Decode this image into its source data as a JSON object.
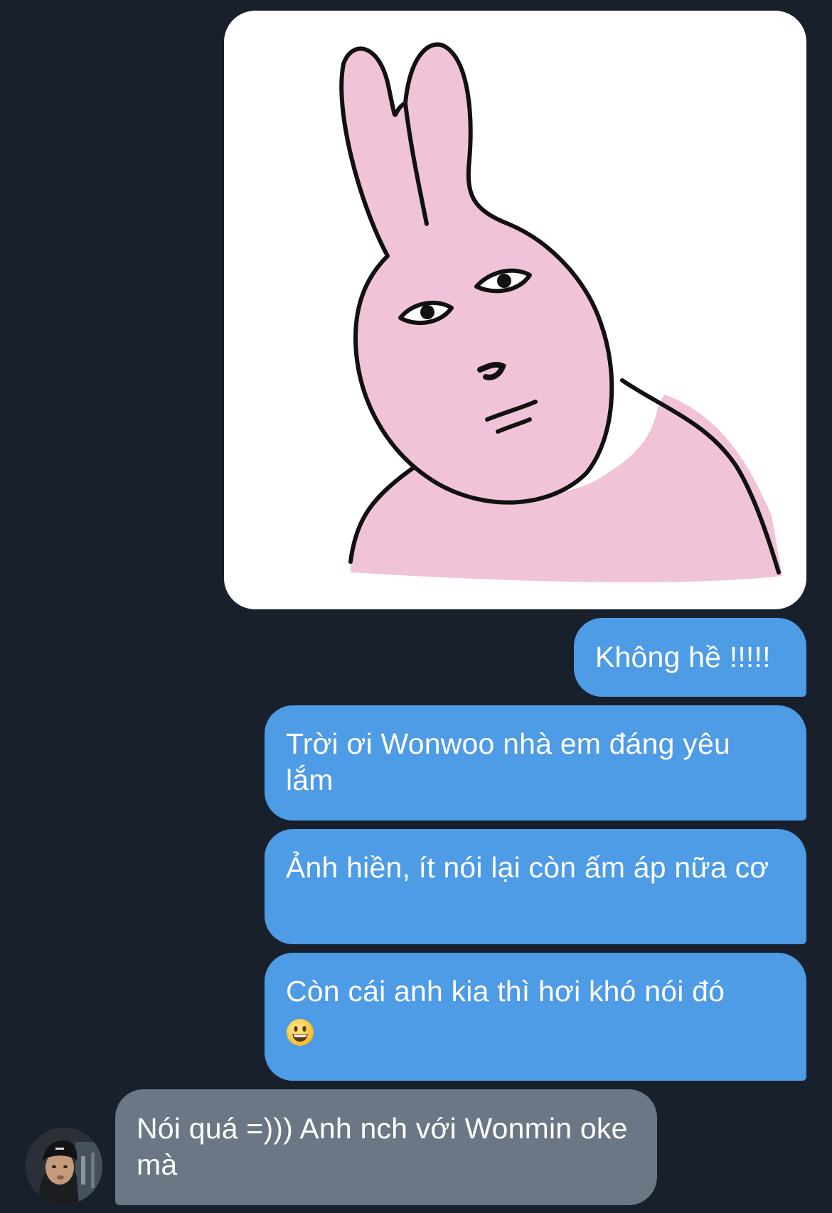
{
  "messages": {
    "sticker": {
      "alt": "pink bunny sticker"
    },
    "outgoing": [
      {
        "text": "Không hề !!!!!"
      },
      {
        "text": "Trời ơi Wonwoo nhà em đáng yêu lắm"
      },
      {
        "text": "Ảnh hiền, ít nói lại còn ấm áp nữa cơ"
      },
      {
        "text": "Còn cái anh kia thì hơi khó nói đó",
        "emoji": "grinning-face"
      }
    ],
    "incoming": [
      {
        "text": "Nói quá =))) Anh nch với Wonmin oke mà"
      }
    ]
  },
  "colors": {
    "background": "#18202b",
    "outgoing_bubble": "#4e9be6",
    "incoming_bubble": "#6b7785",
    "sticker_pink": "#f1c3d9"
  },
  "icons": {
    "emoji": "grinning-face-icon",
    "avatar": "contact-avatar"
  }
}
